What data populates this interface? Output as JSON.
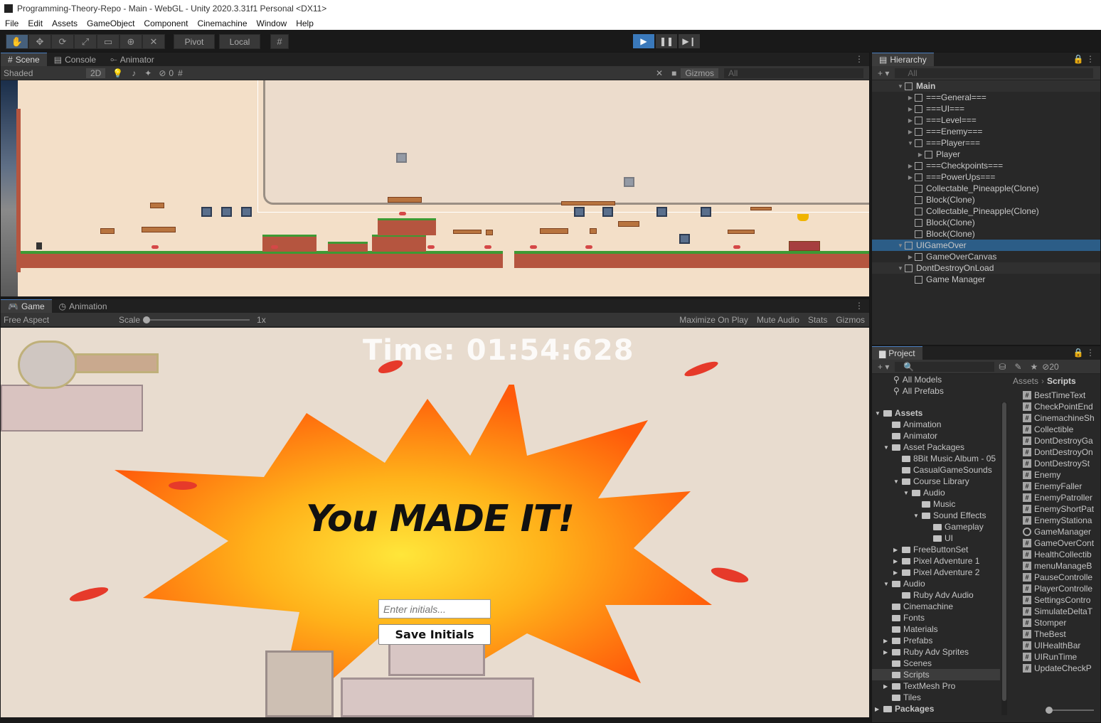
{
  "window_title": "Programming-Theory-Repo - Main - WebGL - Unity 2020.3.31f1 Personal <DX11>",
  "menu": [
    "File",
    "Edit",
    "Assets",
    "GameObject",
    "Component",
    "Cinemachine",
    "Window",
    "Help"
  ],
  "toolbar": {
    "pivot_label": "Pivot",
    "local_label": "Local"
  },
  "scene_panel": {
    "tabs": [
      "Scene",
      "Console",
      "Animator"
    ],
    "shading": "Shaded",
    "mode_2d": "2D",
    "hidden_count": "0",
    "gizmos_label": "Gizmos",
    "search_placeholder": "All"
  },
  "game_panel": {
    "tabs": [
      "Game",
      "Animation"
    ],
    "aspect": "Free Aspect",
    "scale_label": "Scale",
    "scale_value": "1x",
    "maximize_label": "Maximize On Play",
    "mute_label": "Mute Audio",
    "stats_label": "Stats",
    "gizmos_label": "Gizmos",
    "time_text": "Time: 01:54:628",
    "headline": "You MADE IT!",
    "initials_placeholder": "Enter initials...",
    "save_label": "Save Initials"
  },
  "hierarchy": {
    "title": "Hierarchy",
    "search_placeholder": "All",
    "items": [
      {
        "label": "Main",
        "kind": "scene"
      },
      {
        "label": "===General===",
        "kind": "obj"
      },
      {
        "label": "===UI===",
        "kind": "obj"
      },
      {
        "label": "===Level===",
        "kind": "obj"
      },
      {
        "label": "===Enemy===",
        "kind": "obj"
      },
      {
        "label": "===Player===",
        "kind": "obj"
      },
      {
        "label": "Player",
        "kind": "obj"
      },
      {
        "label": "===Checkpoints===",
        "kind": "obj"
      },
      {
        "label": "===PowerUps===",
        "kind": "obj"
      },
      {
        "label": "Collectable_Pineapple(Clone)",
        "kind": "obj"
      },
      {
        "label": "Block(Clone)",
        "kind": "obj"
      },
      {
        "label": "Collectable_Pineapple(Clone)",
        "kind": "obj"
      },
      {
        "label": "Block(Clone)",
        "kind": "obj"
      },
      {
        "label": "Block(Clone)",
        "kind": "obj"
      },
      {
        "label": "UIGameOver",
        "kind": "scene"
      },
      {
        "label": "GameOverCanvas",
        "kind": "obj"
      },
      {
        "label": "DontDestroyOnLoad",
        "kind": "scene"
      },
      {
        "label": "Game Manager",
        "kind": "obj"
      }
    ]
  },
  "project": {
    "title": "Project",
    "hidden_count": "20",
    "breadcrumb": [
      "Assets",
      "Scripts"
    ],
    "favorites": [
      "All Models",
      "All Prefabs"
    ],
    "tree": [
      "Assets",
      "Animation",
      "Animator",
      "Asset Packages",
      "8Bit Music Album - 05",
      "CasualGameSounds",
      "Course Library",
      "Audio",
      "Music",
      "Sound Effects",
      "Gameplay",
      "UI",
      "FreeButtonSet",
      "Pixel Adventure 1",
      "Pixel Adventure 2",
      "Audio",
      "Ruby Adv Audio",
      "Cinemachine",
      "Fonts",
      "Materials",
      "Prefabs",
      "Ruby Adv Sprites",
      "Scenes",
      "Scripts",
      "TextMesh Pro",
      "Tiles",
      "Packages"
    ],
    "scripts": [
      "BestTimeText",
      "CheckPointEnd",
      "CinemachineSh",
      "Collectible",
      "DontDestroyGa",
      "DontDestroyOn",
      "DontDestroySt",
      "Enemy",
      "EnemyFaller",
      "EnemyPatroller",
      "EnemyShortPat",
      "EnemyStationa",
      "GameManager",
      "GameOverCont",
      "HealthCollectib",
      "menuManageB",
      "PauseControlle",
      "PlayerControlle",
      "SettingsContro",
      "SimulateDeltaT",
      "Stomper",
      "TheBest",
      "UIHealthBar",
      "UIRunTime",
      "UpdateCheckP"
    ]
  },
  "colors": {
    "play_active": "#3a79bb",
    "selection": "#2c5d87",
    "tab_highlight": "#4b7fc1"
  }
}
